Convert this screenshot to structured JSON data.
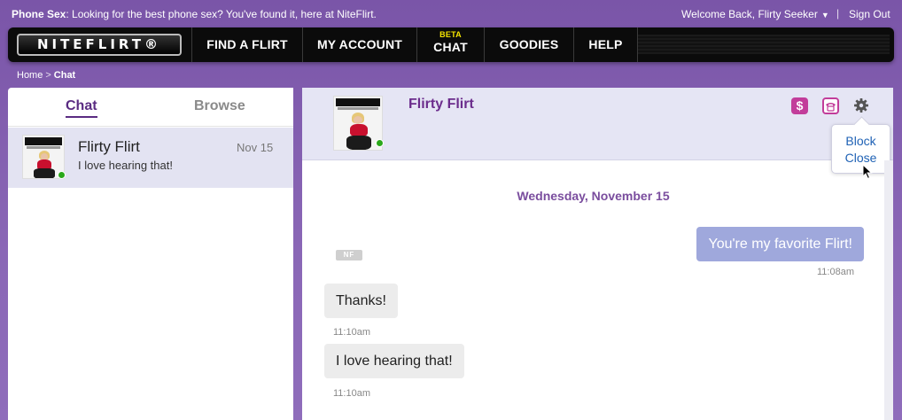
{
  "topbar": {
    "promo_label": "Phone Sex",
    "promo_text": ": Looking for the best phone sex? You've found it, here at NiteFlirt.",
    "welcome": "Welcome Back, Flirty Seeker",
    "separator": "|",
    "signout": "Sign Out"
  },
  "nav": {
    "logo": "NITEFLIRT®",
    "items": [
      {
        "label": "FIND A FLIRT"
      },
      {
        "label": "MY ACCOUNT"
      },
      {
        "label": "CHAT",
        "badge": "BETA"
      },
      {
        "label": "GOODIES"
      },
      {
        "label": "HELP"
      }
    ]
  },
  "breadcrumb": {
    "home": "Home",
    "sep": ">",
    "current": "Chat"
  },
  "left": {
    "tabs": [
      "Chat",
      "Browse"
    ],
    "conversations": [
      {
        "name": "Flirty Flirt",
        "date": "Nov 15",
        "preview": "I love hearing that!",
        "online": true
      }
    ]
  },
  "chat": {
    "header_name": "Flirty Flirt",
    "icons": [
      "dollar-icon",
      "phone-icon",
      "gear-icon"
    ],
    "menu": {
      "block": "Block",
      "close": "Close"
    },
    "day_label": "Wednesday, November 15",
    "nf_badge": "NF",
    "messages": [
      {
        "dir": "out",
        "text": "You're my favorite Flirt!",
        "time": "11:08am"
      },
      {
        "dir": "in",
        "text": "Thanks!",
        "time": "11:10am"
      },
      {
        "dir": "in",
        "text": "I love hearing that!",
        "time": "11:10am"
      }
    ],
    "colors": {
      "accent": "#6b2c8c",
      "outgoing_bubble": "#9fa8dc",
      "incoming_bubble": "#ececec",
      "online": "#2aa81a"
    }
  }
}
